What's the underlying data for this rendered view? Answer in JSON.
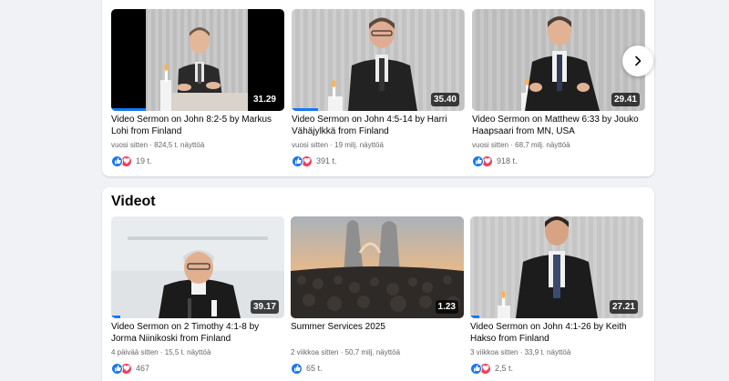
{
  "recent": {
    "videos": [
      {
        "title": "Video Sermon on John 8:2-5 by Markus Lohi from Finland",
        "meta": "vuosi sitten · 824,5 t. näyttöä",
        "duration": "31.29",
        "reactions": "19 t.",
        "progress": 0.2
      },
      {
        "title": "Video Sermon on John 4:5-14 by Harri Vähäjylkkä from Finland",
        "meta": "vuosi sitten · 19 milj. näyttöä",
        "duration": "35.40",
        "reactions": "391 t.",
        "progress": 0.15
      },
      {
        "title": "Video Sermon on Matthew 6:33 by Jouko Haapsaari from MN, USA",
        "meta": "vuosi sitten · 68,7 milj. näyttöä",
        "duration": "29.41",
        "reactions": "918 t.",
        "progress": 0.0
      }
    ]
  },
  "videos_section": {
    "title": "Videot",
    "videos": [
      {
        "title": "Video Sermon on 2 Timothy 4:1-8 by Jorma Niinikoski from Finland",
        "meta": "4 päivää sitten · 15,5 t. näyttöä",
        "duration": "39.17",
        "reactions": "467",
        "progress": 0.05
      },
      {
        "title": "Summer Services 2025",
        "meta": "2 viikkoa sitten · 50,7 milj. näyttöä",
        "duration": "1.23",
        "reactions": "65 t.",
        "progress": 0.0
      },
      {
        "title": "Video Sermon on John 4:1-26 by Keith Hakso from Finland",
        "meta": "3 viikkoa sitten · 33,9 t. näyttöä",
        "duration": "27.21",
        "reactions": "2,5 t.",
        "progress": 0.05
      }
    ]
  },
  "colors": {
    "accent": "#1877f2",
    "love": "#f33e58"
  },
  "icons": {
    "next": "chevron-right-icon",
    "like": "thumbs-up-icon",
    "love": "heart-icon"
  }
}
